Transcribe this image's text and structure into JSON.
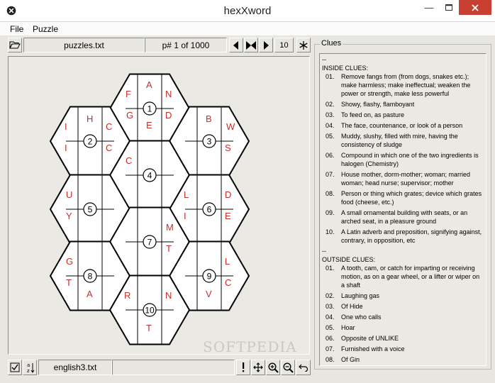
{
  "window": {
    "title": "hexXword"
  },
  "menu": {
    "file": "File",
    "puzzle": "Puzzle"
  },
  "toolbar": {
    "filename": "puzzles.txt",
    "puzzle_number": "p# 1 of 1000",
    "size": "10"
  },
  "statusbar": {
    "dictionary": "english3.txt"
  },
  "board": {
    "hexes": [
      {
        "number": "1",
        "letters": [
          "F",
          "A",
          "N",
          "G",
          "D",
          "E"
        ]
      },
      {
        "number": "2",
        "letters": [
          "I",
          "H",
          "C",
          "I",
          "C"
        ]
      },
      {
        "number": "3",
        "letters": [
          "B",
          "W",
          "S"
        ]
      },
      {
        "number": "4",
        "letters": [
          "C"
        ]
      },
      {
        "number": "5",
        "letters": [
          "U",
          "Y"
        ]
      },
      {
        "number": "6",
        "letters": [
          "L",
          "D",
          "I",
          "E"
        ]
      },
      {
        "number": "7",
        "letters": [
          "M",
          "T"
        ]
      },
      {
        "number": "8",
        "letters": [
          "G",
          "T",
          "A"
        ]
      },
      {
        "number": "9",
        "letters": [
          "L",
          "C",
          "V"
        ]
      },
      {
        "number": "10",
        "letters": [
          "R",
          "N",
          "T"
        ]
      }
    ]
  },
  "clues": {
    "legend": "Clues",
    "dashes": "--",
    "inside_title": "INSIDE CLUES:",
    "inside": [
      {
        "num": "01.",
        "text": "Remove fangs from (from dogs, snakes etc.); make harmless; make ineffectual; weaken the power or strength, make less powerful"
      },
      {
        "num": "02.",
        "text": "Showy, flashy, flamboyant"
      },
      {
        "num": "03.",
        "text": "To feed on, as pasture"
      },
      {
        "num": "04.",
        "text": "The face, countenance, or look of a person"
      },
      {
        "num": "05.",
        "text": "Muddy, slushy, filled with mire, having the consistency of sludge"
      },
      {
        "num": "06.",
        "text": "Compound in which one of the two ingredients is halogen (Chemistry)"
      },
      {
        "num": "07.",
        "text": "House mother, dorm-mother; woman; married woman; head nurse; supervisor; mother"
      },
      {
        "num": "08.",
        "text": "Person or thing which grates; device which grates food (cheese, etc.)"
      },
      {
        "num": "09.",
        "text": "A small ornamental building with seats, or an arched seat, in a pleasure ground"
      },
      {
        "num": "10.",
        "text": "A Latin adverb and preposition, signifying against, contrary, in opposition, etc"
      }
    ],
    "outside_title": "OUTSIDE CLUES:",
    "outside": [
      {
        "num": "01.",
        "text": "A tooth, cam, or catch for imparting or receiving motion, as on a gear wheel, or a lifter or wiper on a shaft"
      },
      {
        "num": "02.",
        "text": "Laughing gas"
      },
      {
        "num": "03.",
        "text": "Of Hide"
      },
      {
        "num": "04.",
        "text": "One who calls"
      },
      {
        "num": "05.",
        "text": "Hoar"
      },
      {
        "num": "06.",
        "text": "Opposite of UNLIKE"
      },
      {
        "num": "07.",
        "text": "Furnished with a voice"
      },
      {
        "num": "08.",
        "text": "Of Gin"
      }
    ]
  },
  "watermark": "SOFTPEDIA",
  "icons": {
    "app": "close-circle-icon",
    "open": "folder-open-icon",
    "prev": "triangle-left-icon",
    "middle": "bowtie-icon",
    "next": "triangle-right-icon",
    "star": "asterisk-icon",
    "check": "checkbox-icon",
    "sort": "sort-az-icon",
    "hint": "exclamation-icon",
    "move": "move-icon",
    "zoom_in": "zoom-in-icon",
    "zoom_out": "zoom-out-icon",
    "undo": "undo-icon"
  }
}
